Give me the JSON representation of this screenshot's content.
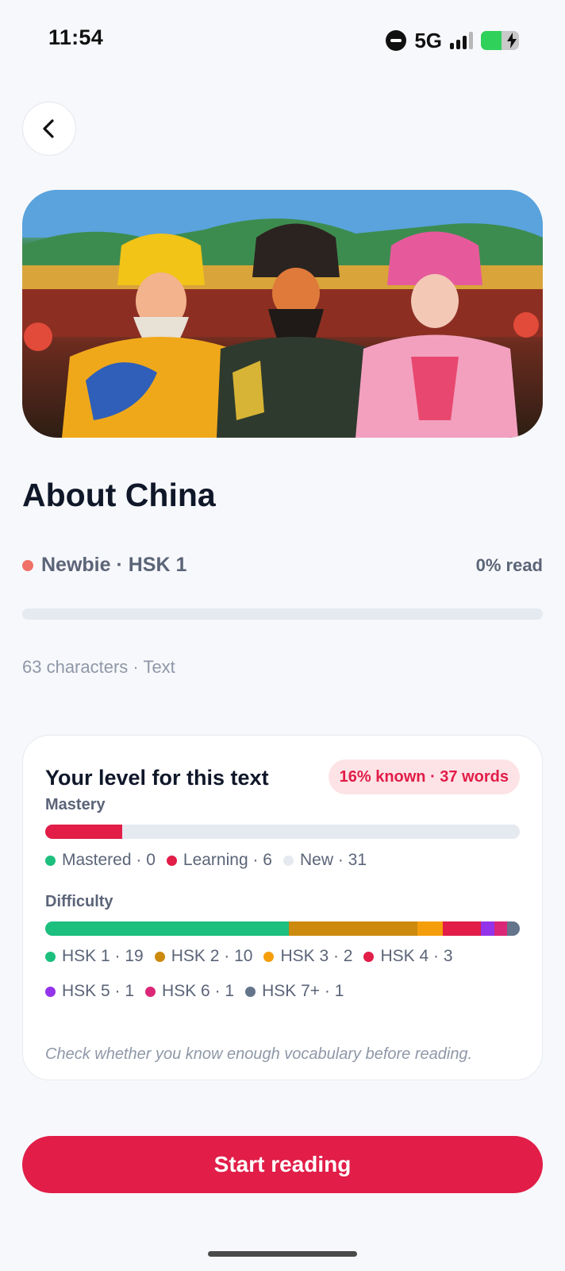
{
  "status_bar": {
    "time": "11:54",
    "network": "5G",
    "signal_bars_filled": 3,
    "signal_bars_total": 4,
    "battery_level": 0.54,
    "charging": true,
    "icons": [
      "do-not-disturb-icon",
      "signal-icon",
      "battery-icon",
      "charging-bolt-icon"
    ]
  },
  "nav": {
    "back_icon": "chevron-left-icon"
  },
  "hero": {
    "description_icon": "hero-image"
  },
  "article": {
    "title": "About China",
    "level_label": "Newbie · HSK 1",
    "level_color": "#f07167",
    "read_progress_label": "0% read",
    "read_progress": 0,
    "info": "63 characters · Text"
  },
  "level_card": {
    "title": "Your level for this text",
    "known_badge": "16% known · 37 words",
    "mastery": {
      "label": "Mastery",
      "segments": [
        {
          "name": "Mastered",
          "count": 0,
          "color": "#1cbf7e"
        },
        {
          "name": "Learning",
          "count": 6,
          "color": "#e11d48"
        },
        {
          "name": "New",
          "count": 31,
          "color": "#e5e9f0"
        }
      ],
      "legend": [
        "Mastered · 0",
        "Learning · 6",
        "New · 31"
      ]
    },
    "difficulty": {
      "label": "Difficulty",
      "segments": [
        {
          "name": "HSK 1",
          "count": 19,
          "color": "#1cbf7e"
        },
        {
          "name": "HSK 2",
          "count": 10,
          "color": "#cc8a0e"
        },
        {
          "name": "HSK 3",
          "count": 2,
          "color": "#f59e0b"
        },
        {
          "name": "HSK 4",
          "count": 3,
          "color": "#e11d48"
        },
        {
          "name": "HSK 5",
          "count": 1,
          "color": "#9333ea"
        },
        {
          "name": "HSK 6",
          "count": 1,
          "color": "#db2777"
        },
        {
          "name": "HSK 7+",
          "count": 1,
          "color": "#64748b"
        }
      ],
      "legend_row1": [
        "HSK 1 · 19",
        "HSK 2 · 10",
        "HSK 3 · 2",
        "HSK 4 · 3"
      ],
      "legend_row2": [
        "HSK 5 · 1",
        "HSK 6 · 1",
        "HSK 7+ · 1"
      ]
    },
    "hint": "Check whether you know enough vocabulary before reading."
  },
  "start_button_label": "Start reading",
  "colors": {
    "accent": "#e11d48",
    "background": "#f7f8fb"
  }
}
